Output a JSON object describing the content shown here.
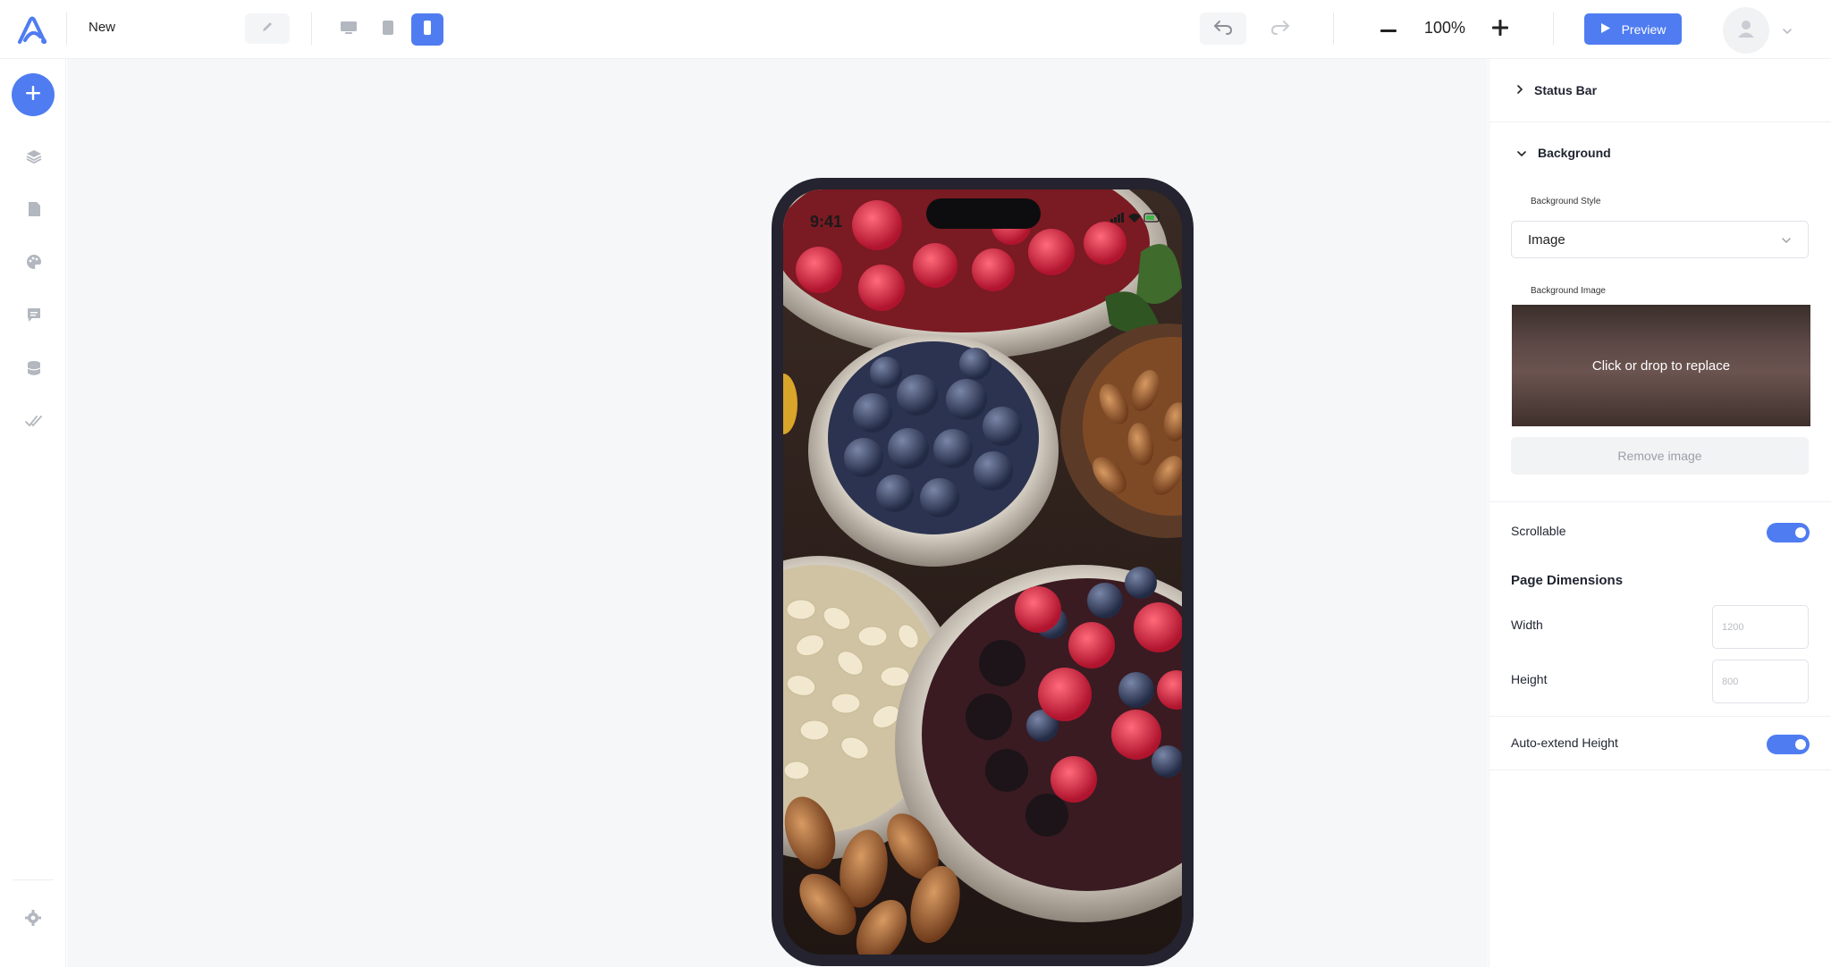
{
  "app": {
    "logo_icon": "brand-logo-icon",
    "project_name": "New"
  },
  "toolbar": {
    "rename_icon": "pencil-icon",
    "devices": [
      {
        "name": "desktop",
        "icon": "monitor-icon",
        "active": false
      },
      {
        "name": "tablet",
        "icon": "tablet-icon",
        "active": false
      },
      {
        "name": "mobile",
        "icon": "phone-icon",
        "active": true
      }
    ],
    "undo_icon": "undo-icon",
    "redo_icon": "redo-icon",
    "zoom_level": "100%",
    "preview_label": "Preview",
    "accent_color": "#4f7cf1"
  },
  "left_rail": {
    "add_icon": "plus-icon",
    "items": [
      "layers-icon",
      "pages-icon",
      "theme-palette-icon",
      "comments-icon",
      "database-icon",
      "checks-icon"
    ],
    "settings_icon": "gear-icon"
  },
  "canvas": {
    "device": {
      "status_time": "9:41",
      "background": "image of berries, nuts and bowls"
    }
  },
  "panel": {
    "status_bar": {
      "title": "Status Bar",
      "expanded": false
    },
    "background": {
      "title": "Background",
      "expanded": true,
      "style_label": "Background Style",
      "style_value": "Image",
      "image_label": "Background Image",
      "replace_text": "Click or drop to replace",
      "remove_label": "Remove image"
    },
    "scrollable": {
      "label": "Scrollable",
      "enabled": true
    },
    "page_dimensions": {
      "title": "Page Dimensions",
      "width_label": "Width",
      "width_placeholder": "1200",
      "height_label": "Height",
      "height_placeholder": "800"
    },
    "auto_extend": {
      "label": "Auto-extend Height",
      "enabled": true
    }
  }
}
